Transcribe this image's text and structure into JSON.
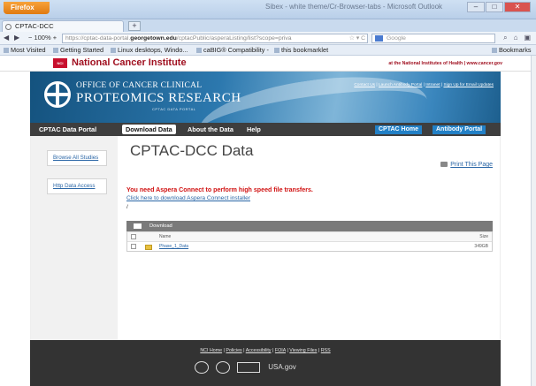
{
  "browser": {
    "menu_button": "Firefox",
    "window_title": "Sibex - white theme/Cr-Browser-tabs - Microsoft Outlook",
    "tab_title": "CPTAC-DCC",
    "new_tab": "+",
    "zoom": "100%",
    "url_prefix": "https://cptac-data-portal.",
    "url_domain": "georgetown.edu",
    "url_path": "/cptacPublic/asperaListing/list?scope=priva",
    "search_placeholder": "Google",
    "bookmarks": [
      "Most Visited",
      "Getting Started",
      "Linux desktops, Windo...",
      "caBIG® Compatibility -",
      "this bookmarklet"
    ],
    "bookmarks_menu": "Bookmarks"
  },
  "nci": {
    "title": "National Cancer Institute",
    "right_text": "at the National Institutes of Health | www.cancer.gov"
  },
  "banner": {
    "line1": "OFFICE OF CANCER CLINICAL",
    "line2": "PROTEOMICS RESEARCH",
    "line3": "CPTAC DATA PORTAL",
    "links": [
      "Contact Us",
      "Launch Antibody Portal",
      "Intranet",
      "Sign Up for Email Updates"
    ]
  },
  "menu": {
    "items": [
      "CPTAC Data Portal",
      "Download Data",
      "About the Data",
      "Help"
    ],
    "buttons": [
      "CPTAC Home",
      "Antibody Portal"
    ]
  },
  "sidebar": {
    "items": [
      "Browse All Studies",
      "Http Data Access"
    ]
  },
  "main": {
    "title": "CPTAC-DCC Data",
    "print": "Print This Page",
    "warning": "You need Aspera Connect to perform high speed file transfers.",
    "download_link": "Click here to download Aspera Connect installer",
    "path": "/",
    "download_label": "Download",
    "table_headers": {
      "name": "Name",
      "size": "Size"
    },
    "rows": [
      {
        "name": "Phase_1_Data",
        "size": "349GB"
      }
    ]
  },
  "footer": {
    "links": [
      "NCI Home",
      "Policies",
      "Accessibility",
      "FOIA",
      "Viewing Files",
      "RSS"
    ],
    "logos": [
      "HHS",
      "NIH",
      "USA.gov"
    ]
  }
}
